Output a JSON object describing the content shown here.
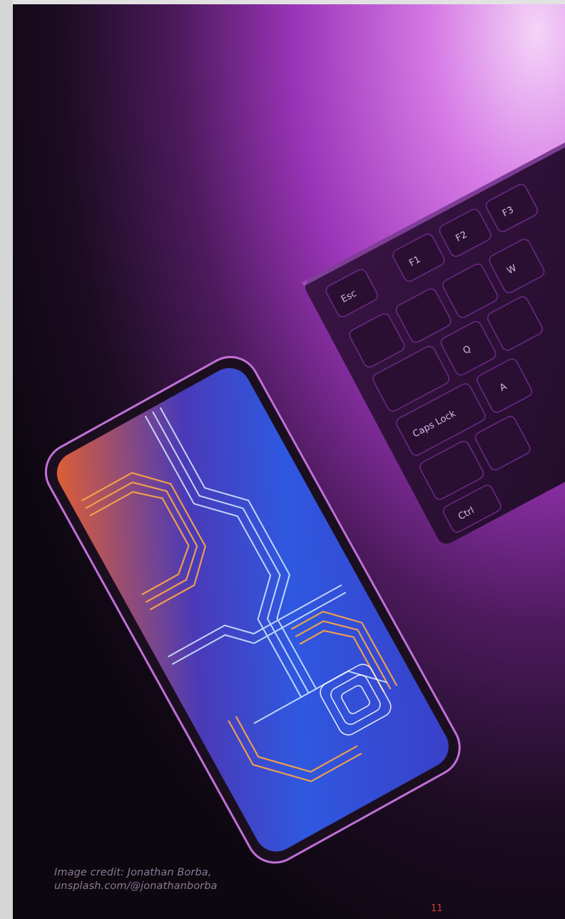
{
  "photo": {
    "description_icon": "desk-phone-keyboard-photo",
    "keycaps": [
      "Esc",
      "F1",
      "F2",
      "F3",
      "Caps Lock",
      "Ctrl",
      "Q",
      "W",
      "A"
    ],
    "colors": {
      "background_light": "#e6b6f0",
      "background_mid": "#8a2aa8",
      "background_dark": "#0d0710",
      "accent_orange": "#f39a3c",
      "accent_blue": "#3d52d8"
    }
  },
  "credit": {
    "line1": "Image credit: Jonathan Borba,",
    "line2": "unsplash.com/@jonathanborba"
  },
  "page_number": "11"
}
